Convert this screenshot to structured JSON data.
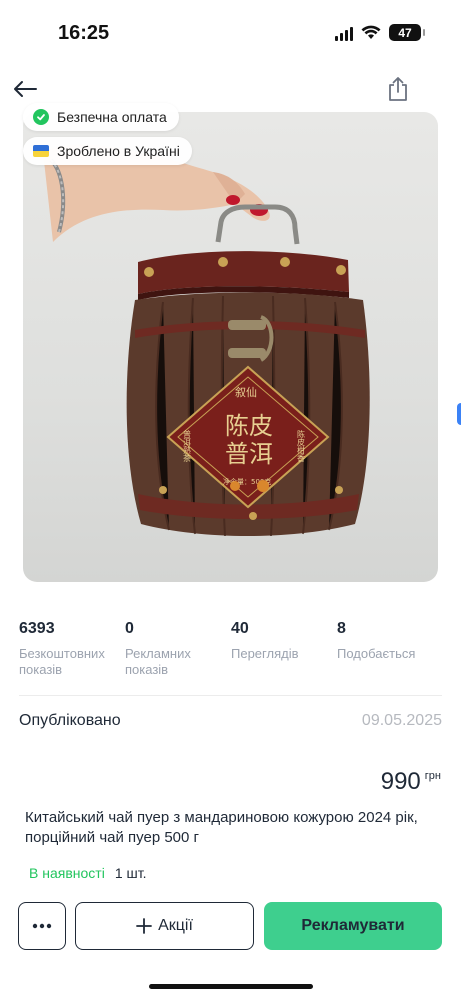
{
  "status_bar": {
    "time": "16:25",
    "battery": "47"
  },
  "badges": {
    "secure": "Безпечна оплата",
    "made_in": "Зроблено в Україні"
  },
  "photo": {
    "alt": "Wooden tea barrel with label",
    "label_big": "陈皮\n普洱",
    "label_left": "普洱熟茶",
    "label_right": "陈皮柑香",
    "label_weight": "净含量：500克",
    "label_logo": "叙仙"
  },
  "stats": [
    {
      "value": "6393",
      "label": "Безкоштовних показів"
    },
    {
      "value": "0",
      "label": "Рекламних показів"
    },
    {
      "value": "40",
      "label": "Переглядів"
    },
    {
      "value": "8",
      "label": "Подобається"
    }
  ],
  "published": {
    "label": "Опубліковано",
    "date": "09.05.2025"
  },
  "price": {
    "value": "990",
    "currency": "грн"
  },
  "listing": {
    "title": "Китайський чай пуер з мандариновою кожурою 2024 рік, порційний чай пуер 500 г"
  },
  "stock": {
    "status": "В наявності",
    "quantity": "1 шт."
  },
  "actions": {
    "promotions": "Акції",
    "advertise": "Рекламувати"
  },
  "colors": {
    "accent_green": "#3ecf8e",
    "stock_green": "#22c55e",
    "side_dot": "#3b82f6"
  }
}
